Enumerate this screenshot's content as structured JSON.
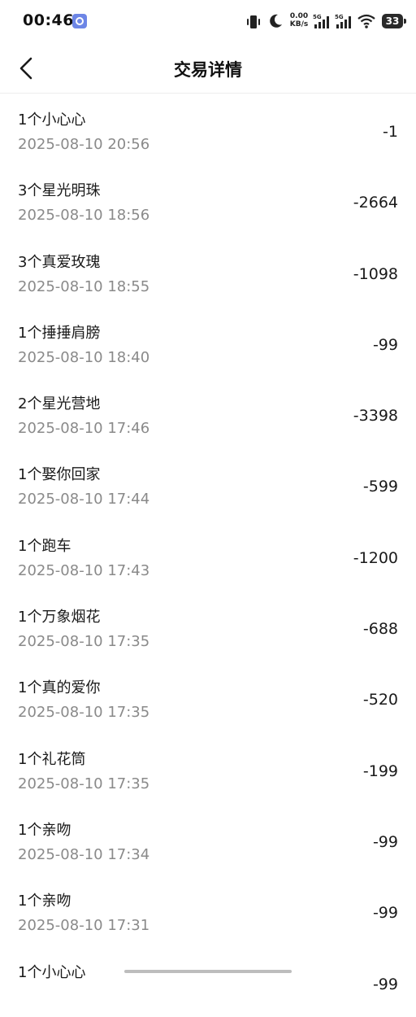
{
  "status_bar": {
    "time": "00:46",
    "net_speed_value": "0.00",
    "net_speed_unit": "KB/s",
    "battery": "33",
    "icons": [
      "app-notification-icon",
      "vibrate-icon",
      "moon-icon",
      "signal-5g-icon",
      "signal-5g-icon",
      "wifi-icon",
      "battery-icon"
    ]
  },
  "header": {
    "title": "交易详情",
    "back_icon": "chevron-left-icon"
  },
  "transactions": [
    {
      "name": "1个小心心",
      "time": "2025-08-10 20:56",
      "amount": "-1"
    },
    {
      "name": "3个星光明珠",
      "time": "2025-08-10 18:56",
      "amount": "-2664"
    },
    {
      "name": "3个真爱玫瑰",
      "time": "2025-08-10 18:55",
      "amount": "-1098"
    },
    {
      "name": "1个捶捶肩膀",
      "time": "2025-08-10 18:40",
      "amount": "-99"
    },
    {
      "name": "2个星光营地",
      "time": "2025-08-10 17:46",
      "amount": "-3398"
    },
    {
      "name": "1个娶你回家",
      "time": "2025-08-10 17:44",
      "amount": "-599"
    },
    {
      "name": "1个跑车",
      "time": "2025-08-10 17:43",
      "amount": "-1200"
    },
    {
      "name": "1个万象烟花",
      "time": "2025-08-10 17:35",
      "amount": "-688"
    },
    {
      "name": "1个真的爱你",
      "time": "2025-08-10 17:35",
      "amount": "-520"
    },
    {
      "name": "1个礼花筒",
      "time": "2025-08-10 17:35",
      "amount": "-199"
    },
    {
      "name": "1个亲吻",
      "time": "2025-08-10 17:34",
      "amount": "-99"
    },
    {
      "name": "1个亲吻",
      "time": "2025-08-10 17:31",
      "amount": "-99"
    },
    {
      "name": "1个小心心",
      "time": "",
      "amount": "-99"
    }
  ],
  "colors": {
    "text_primary": "#1a1a1a",
    "text_secondary": "#8a8a8a",
    "background": "#ffffff",
    "divider": "#ededed"
  }
}
